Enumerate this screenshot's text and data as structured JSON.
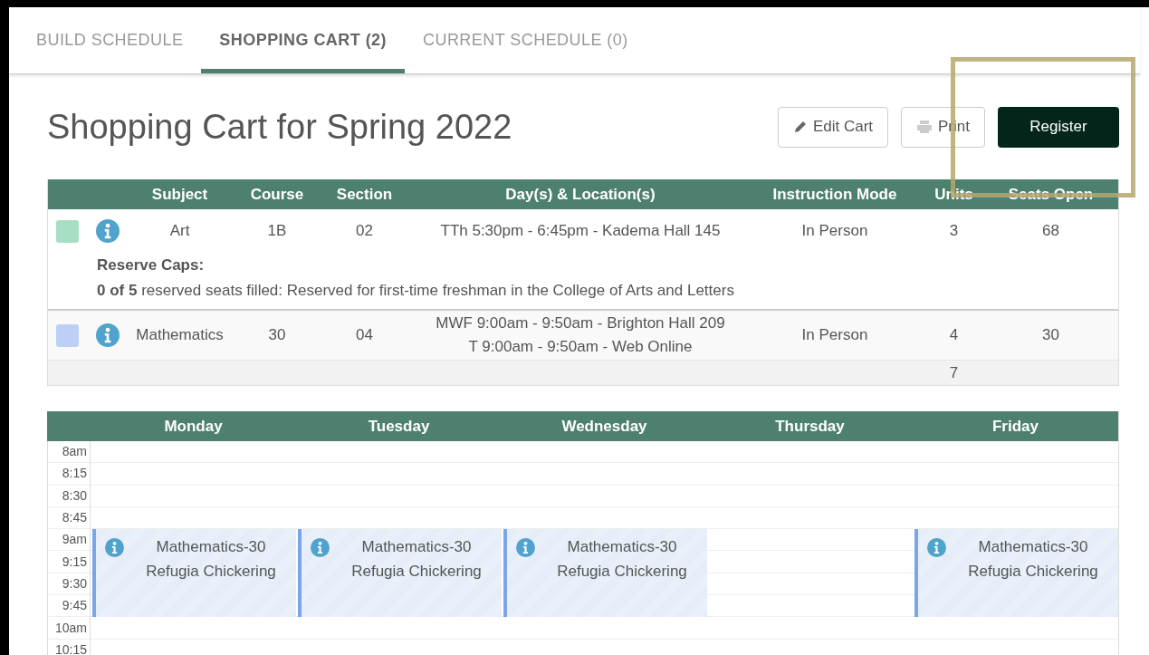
{
  "tabs": [
    {
      "label": "BUILD SCHEDULE",
      "selected": false
    },
    {
      "label": "SHOPPING CART (2)",
      "selected": true
    },
    {
      "label": "CURRENT SCHEDULE (0)",
      "selected": false
    }
  ],
  "title": "Shopping Cart for Spring 2022",
  "buttons": [
    {
      "label": "Edit Cart",
      "kind": "edit"
    },
    {
      "label": "Print",
      "kind": "print"
    },
    {
      "label": "Register",
      "kind": "primary"
    }
  ],
  "cart": {
    "columns": [
      "Subject",
      "Course",
      "Section",
      "Day(s) & Location(s)",
      "Instruction Mode",
      "Units",
      "Seats Open"
    ],
    "rows": [
      {
        "color": "#a8dfc4",
        "subject": "Art",
        "course": "1B",
        "section": "02",
        "locations": [
          "TTh 5:30pm - 6:45pm - Kadema Hall 145"
        ],
        "mode": "In Person",
        "units": "3",
        "seats": "68",
        "reserve": {
          "label": "Reserve Caps:",
          "text": "**0 of 5** reserved seats filled: Reserved for first-time freshman in the College of Arts and Letters"
        }
      },
      {
        "color": "#bcd0f5",
        "subject": "Mathematics",
        "course": "30",
        "section": "04",
        "locations": [
          "MWF 9:00am - 9:50am - Brighton Hall 209",
          "T 9:00am - 9:50am - Web Online"
        ],
        "mode": "In Person",
        "units": "4",
        "seats": "30"
      }
    ],
    "total_units": "7"
  },
  "calendar": {
    "times": [
      "8am",
      "8:15",
      "8:30",
      "8:45",
      "9am",
      "9:15",
      "9:30",
      "9:45",
      "10am",
      "10:15"
    ],
    "days": [
      {
        "name": "Monday",
        "events": [
          {
            "title": "Mathematics-30",
            "instructor": "Refugia Chickering"
          }
        ]
      },
      {
        "name": "Tuesday",
        "events": [
          {
            "title": "Mathematics-30",
            "instructor": "Refugia Chickering"
          }
        ]
      },
      {
        "name": "Wednesday",
        "events": [
          {
            "title": "Mathematics-30",
            "instructor": "Refugia Chickering"
          }
        ]
      },
      {
        "name": "Thursday"
      },
      {
        "name": "Friday",
        "events": [
          {
            "title": "Mathematics-30",
            "instructor": "Refugia Chickering"
          }
        ]
      }
    ]
  }
}
